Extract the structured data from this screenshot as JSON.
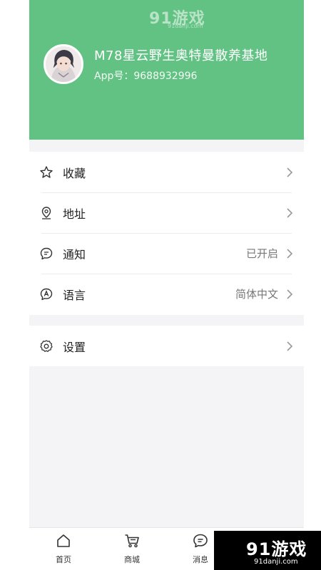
{
  "header": {
    "username": "M78星云野生奥特曼散养基地",
    "app_id": "App号：9688932996",
    "bg_color": "#62c283"
  },
  "watermark": {
    "logo": "91游戏",
    "domain": "91danji.com"
  },
  "menu_group_1": [
    {
      "label": "收藏",
      "value": "",
      "icon": "star-icon"
    },
    {
      "label": "地址",
      "value": "",
      "icon": "location-pin-icon"
    },
    {
      "label": "通知",
      "value": "已开启",
      "icon": "message-bubble-icon"
    },
    {
      "label": "语言",
      "value": "简体中文",
      "icon": "language-icon"
    }
  ],
  "menu_group_2": [
    {
      "label": "设置",
      "value": "",
      "icon": "gear-icon"
    }
  ],
  "tabbar": [
    {
      "label": "首页",
      "icon": "home-icon"
    },
    {
      "label": "商城",
      "icon": "cart-icon"
    },
    {
      "label": "消息",
      "icon": "chat-icon"
    }
  ]
}
